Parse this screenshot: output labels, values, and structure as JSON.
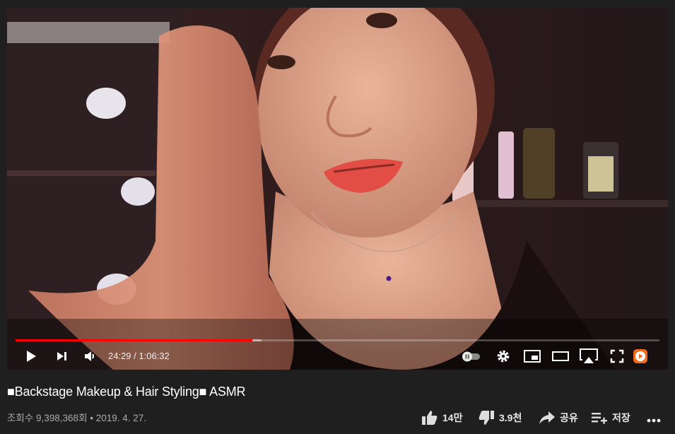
{
  "video": {
    "current_time": "24:29",
    "separator": " / ",
    "duration": "1:06:32",
    "played_fraction": 0.368,
    "buffered_fraction": 0.382
  },
  "info": {
    "title": "■Backstage Makeup & Hair Styling■ ASMR",
    "views": "조회수 9,398,368회",
    "dot": " • ",
    "date": "2019. 4. 27."
  },
  "actions": {
    "like_count": "14만",
    "dislike_count": "3.9천",
    "share_label": "공유",
    "save_label": "저장"
  },
  "colors": {
    "progress": "#ff0000",
    "background": "#1f1f1f"
  }
}
